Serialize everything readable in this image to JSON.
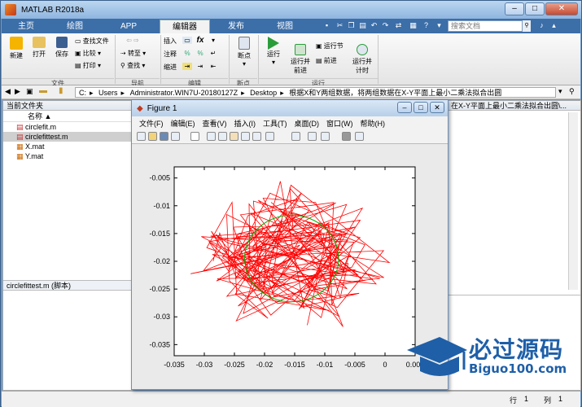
{
  "window": {
    "title": "MATLAB R2018a"
  },
  "tabs": [
    {
      "label": "主页",
      "active": false
    },
    {
      "label": "绘图",
      "active": false
    },
    {
      "label": "APP",
      "active": false
    },
    {
      "label": "编辑器",
      "active": true
    },
    {
      "label": "发布",
      "active": false
    },
    {
      "label": "视图",
      "active": false
    }
  ],
  "search": {
    "placeholder": "搜索文档"
  },
  "ribbon": {
    "file": {
      "new": "新建",
      "open": "打开",
      "save": "保存",
      "find_files": "查找文件",
      "compare": "比较",
      "print": "打印",
      "section": "文件"
    },
    "navigate": {
      "goto": "转至",
      "find": "查找",
      "section": "导航"
    },
    "edit": {
      "insert": "插入",
      "comment": "注释",
      "indent": "缩进",
      "fx": "fx",
      "section": "编辑"
    },
    "breakpoints": {
      "label": "断点",
      "section": "断点"
    },
    "run": {
      "run": "运行",
      "run_advance": "运行并\n前进",
      "run_section": "运行节",
      "advance": "前进",
      "run_time": "运行并\n计时",
      "section": "运行"
    }
  },
  "address": {
    "parts": [
      "C:",
      "Users",
      "Administrator.WIN7U-20180127Z",
      "Desktop",
      "根据X和Y两组数据，将两组数据在X-Y平面上最小二乘法拟合出圆"
    ]
  },
  "current_folder": {
    "title": "当前文件夹",
    "column": "名称 ▲",
    "files": [
      {
        "name": "circlefit.m",
        "selected": false,
        "icon": "m-file-icon"
      },
      {
        "name": "circlefittest.m",
        "selected": true,
        "icon": "m-file-icon"
      },
      {
        "name": "X.mat",
        "selected": false,
        "icon": "mat-file-icon"
      },
      {
        "name": "Y.mat",
        "selected": false,
        "icon": "mat-file-icon"
      }
    ],
    "details": "circlefittest.m  (脚本)"
  },
  "editor_tab": "在X-Y平面上最小二乘法拟合出圆\\...",
  "status": {
    "row_label": "行",
    "row": "1",
    "col_label": "列",
    "col": "1"
  },
  "figure": {
    "title": "Figure 1",
    "menu": [
      "文件(F)",
      "编辑(E)",
      "查看(V)",
      "插入(I)",
      "工具(T)",
      "桌面(D)",
      "窗口(W)",
      "帮助(H)"
    ]
  },
  "chart_data": {
    "type": "line",
    "title": "",
    "xlabel": "",
    "ylabel": "",
    "xlim": [
      -0.035,
      0.005
    ],
    "ylim": [
      -0.037,
      -0.003
    ],
    "xticks": [
      "-0.035",
      "-0.03",
      "-0.025",
      "-0.02",
      "-0.015",
      "-0.01",
      "-0.005",
      "0",
      "0.005"
    ],
    "yticks": [
      "-0.005",
      "-0.01",
      "-0.015",
      "-0.02",
      "-0.025",
      "-0.03",
      "-0.035"
    ],
    "series": [
      {
        "kind": "noisy-data",
        "color": "#ff0000",
        "center": [
          -0.0155,
          -0.0195
        ],
        "radius": 0.0085
      },
      {
        "kind": "fit-circle",
        "color": "#00b000",
        "center": [
          -0.0155,
          -0.0195
        ],
        "radius": 0.0078
      }
    ]
  },
  "watermark": {
    "title": "必过源码",
    "url": "Biguo100.com"
  },
  "colors": {
    "accent": "#3c6ea8",
    "data": "#ff0000",
    "fit": "#00b000"
  }
}
